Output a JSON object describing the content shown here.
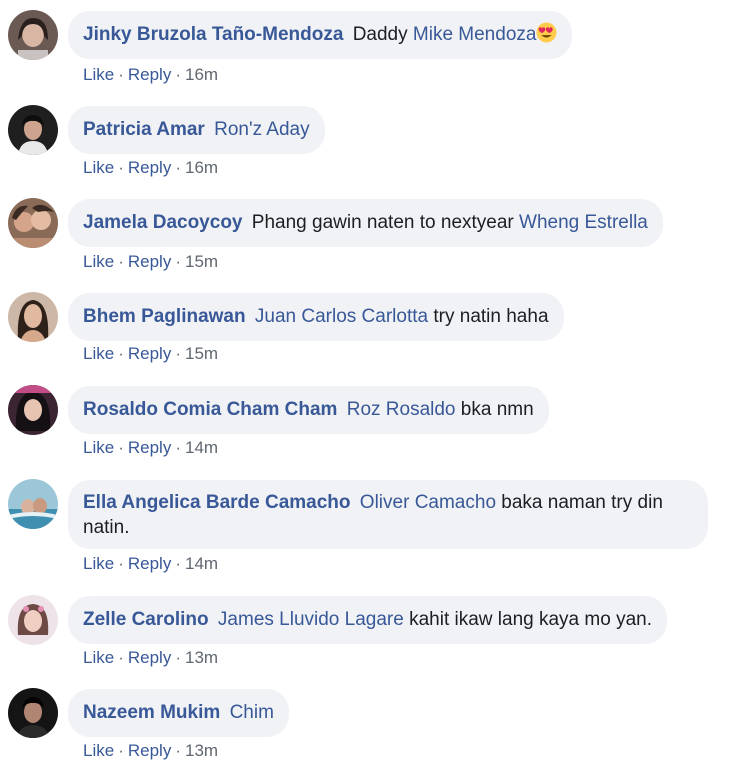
{
  "actions": {
    "like": "Like",
    "reply": "Reply",
    "separator": "·"
  },
  "comments": [
    {
      "author": "Jinky Bruzola Taño-Mendoza",
      "before": "Daddy",
      "mention": "Mike Mendoza",
      "after": "",
      "time": "16m",
      "emoji": "heart-eyes-emoji"
    },
    {
      "author": "Patricia Amar",
      "before": "",
      "mention": "Ron'z Aday",
      "after": "",
      "time": "16m"
    },
    {
      "author": "Jamela Dacoycoy",
      "before": "Phang gawin naten to nextyear",
      "mention": "Wheng Estrella",
      "after": "",
      "time": "15m"
    },
    {
      "author": "Bhem Paglinawan",
      "before": "",
      "mention": "Juan Carlos Carlotta",
      "after": "try natin haha",
      "time": "15m"
    },
    {
      "author": "Rosaldo Comia Cham Cham",
      "before": "",
      "mention": "Roz Rosaldo",
      "after": "bka nmn",
      "time": "14m"
    },
    {
      "author": "Ella Angelica Barde Camacho",
      "before": "",
      "mention": "Oliver Camacho",
      "after": "baka naman try din natin.",
      "time": "14m"
    },
    {
      "author": "Zelle Carolino",
      "before": "",
      "mention": "James Lluvido Lagare",
      "after": "kahit ikaw lang kaya mo yan.",
      "time": "13m"
    },
    {
      "author": "Nazeem Mukim",
      "before": "",
      "mention": "Chim",
      "after": "",
      "time": "13m"
    }
  ],
  "colors": {
    "name": "#385898",
    "bubble": "#f0f2f5",
    "meta_time": "#606770"
  }
}
